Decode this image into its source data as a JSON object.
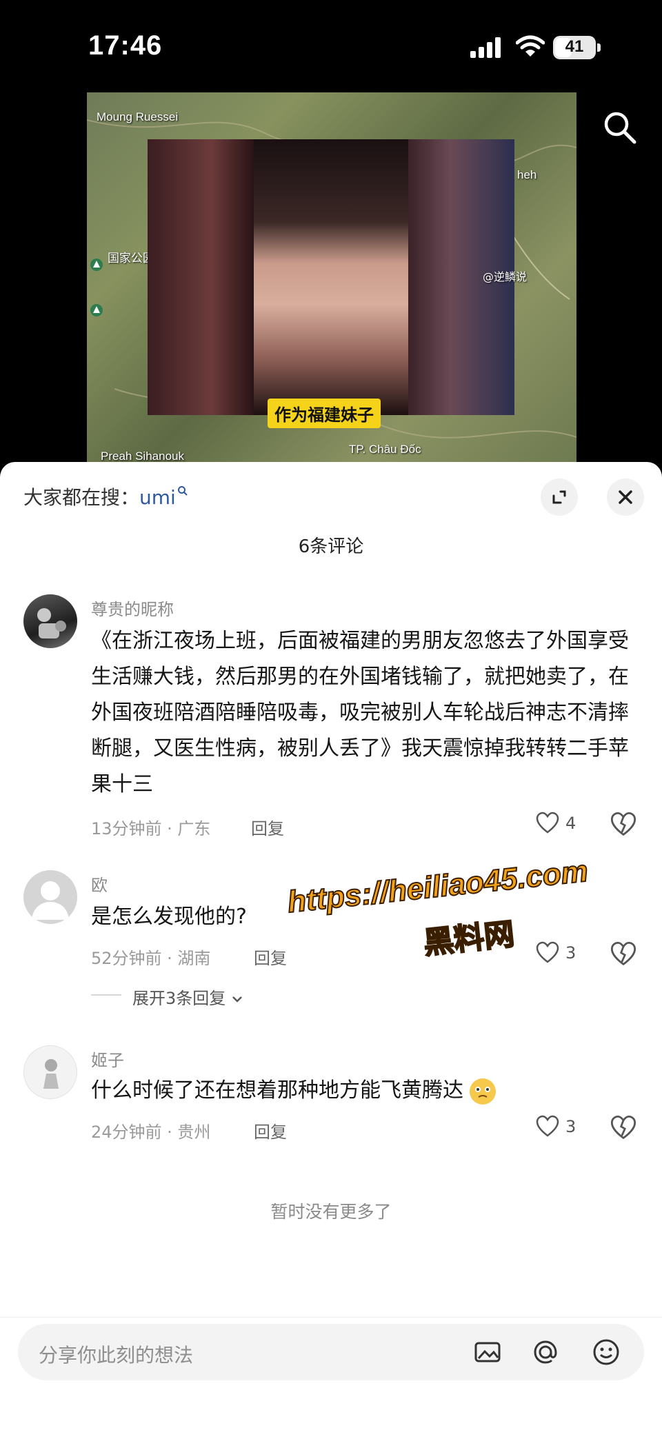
{
  "status_bar": {
    "time": "17:46",
    "battery": "41"
  },
  "video": {
    "map_labels": [
      "Moung Ruessei",
      "国家公园",
      "Preah Sihanouk",
      "TP. Châu Đốc",
      "heh"
    ],
    "subtitle": "作为福建妹子",
    "watermark": "@逆鳞说"
  },
  "comments_panel": {
    "trending_prefix": "大家都在搜：",
    "trending_keyword": "umi",
    "comment_count": "6条评论",
    "comments": [
      {
        "username": "尊贵的昵称",
        "text": "《在浙江夜场上班，后面被福建的男朋友忽悠去了外国享受生活赚大钱，然后那男的在外国堵钱输了，就把她卖了，在外国夜班陪酒陪睡陪吸毒，吸完被别人车轮战后神志不清摔断腿，又医生性病，被别人丢了》我天震惊掉我转转二手苹果十三",
        "meta": "13分钟前 · 广东",
        "reply_label": "回复",
        "likes": "4"
      },
      {
        "username": "欧",
        "text": "是怎么发现他的?",
        "meta": "52分钟前 · 湖南",
        "reply_label": "回复",
        "likes": "3",
        "expand_label": "展开3条回复"
      },
      {
        "username": "姬子",
        "text": "什么时候了还在想着那种地方能飞黄腾达",
        "meta": "24分钟前 · 贵州",
        "reply_label": "回复",
        "likes": "3"
      }
    ],
    "no_more_text": "暂时没有更多了",
    "input_placeholder": "分享你此刻的想法"
  },
  "site_watermark": {
    "url": "https://heiliao45.com",
    "name": "黑料网"
  },
  "colors": {
    "accent_link": "#2f5a9c",
    "subtitle_bg": "#f5d31a",
    "watermark": "#f2a11a"
  }
}
